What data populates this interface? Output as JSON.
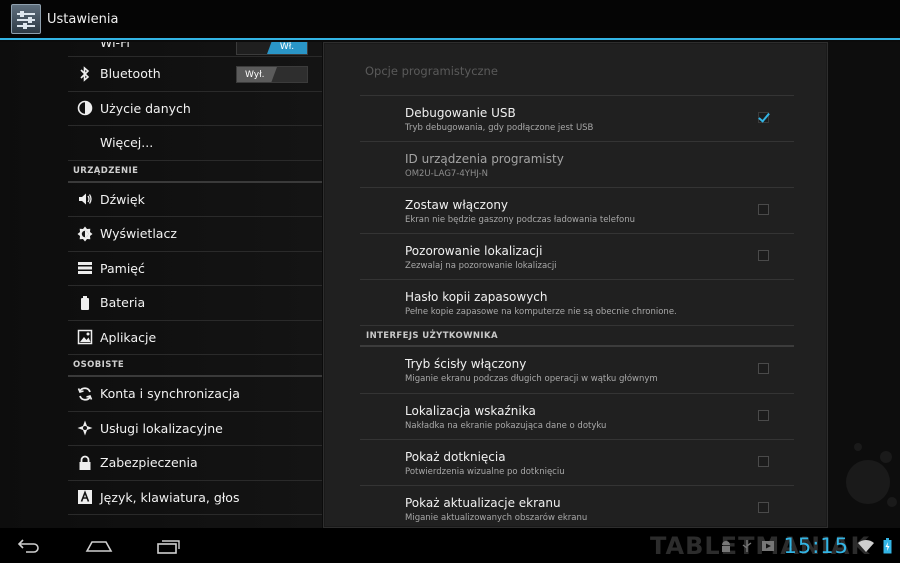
{
  "actionbar": {
    "title": "Ustawienia"
  },
  "left": {
    "wifi": {
      "label": "Wi-Fi",
      "toggle": "Wł."
    },
    "bluetooth": {
      "label": "Bluetooth",
      "toggle": "Wył."
    },
    "data_usage": {
      "label": "Użycie danych"
    },
    "more": {
      "label": "Więcej..."
    },
    "section_device": "URZĄDZENIE",
    "sound": {
      "label": "Dźwięk"
    },
    "display": {
      "label": "Wyświetlacz"
    },
    "storage": {
      "label": "Pamięć"
    },
    "battery": {
      "label": "Bateria"
    },
    "apps": {
      "label": "Aplikacje"
    },
    "section_personal": "OSOBISTE",
    "accounts": {
      "label": "Konta i synchronizacja"
    },
    "location": {
      "label": "Usługi lokalizacyjne"
    },
    "security": {
      "label": "Zabezpieczenia"
    },
    "language": {
      "label": "Język, klawiatura, głos"
    }
  },
  "panel": {
    "title": "Opcje programistyczne",
    "items": [
      {
        "title": "Debugowanie USB",
        "summary": "Tryb debugowania, gdy podłączone jest USB",
        "checked": true
      },
      {
        "title": "ID urządzenia programisty",
        "summary": "OM2U-LAG7-4YHJ-N"
      },
      {
        "title": "Zostaw włączony",
        "summary": "Ekran nie będzie gaszony podczas ładowania telefonu",
        "checked": false
      },
      {
        "title": "Pozorowanie lokalizacji",
        "summary": "Zezwalaj na pozorowanie lokalizacji",
        "checked": false
      },
      {
        "title": "Hasło kopii zapasowych",
        "summary": "Pełne kopie zapasowe na komputerze nie są obecnie chronione."
      }
    ],
    "section_ui": "INTERFEJS UŻYTKOWNIKA",
    "ui_items": [
      {
        "title": "Tryb ścisły włączony",
        "summary": "Miganie ekranu podczas długich operacji w wątku głównym",
        "checked": false
      },
      {
        "title": "Lokalizacja wskaźnika",
        "summary": "Nakładka na ekranie pokazująca dane o dotyku",
        "checked": false
      },
      {
        "title": "Pokaż dotknięcia",
        "summary": "Potwierdzenia wizualne po dotknięciu",
        "checked": false
      },
      {
        "title": "Pokaż aktualizacje ekranu",
        "summary": "Miganie aktualizowanych obszarów ekranu",
        "checked": false
      }
    ]
  },
  "statusbar": {
    "time": "15:15",
    "watermark": "TABLETMANIAK"
  },
  "colors": {
    "accent": "#33b5e5",
    "background": "#202020"
  }
}
